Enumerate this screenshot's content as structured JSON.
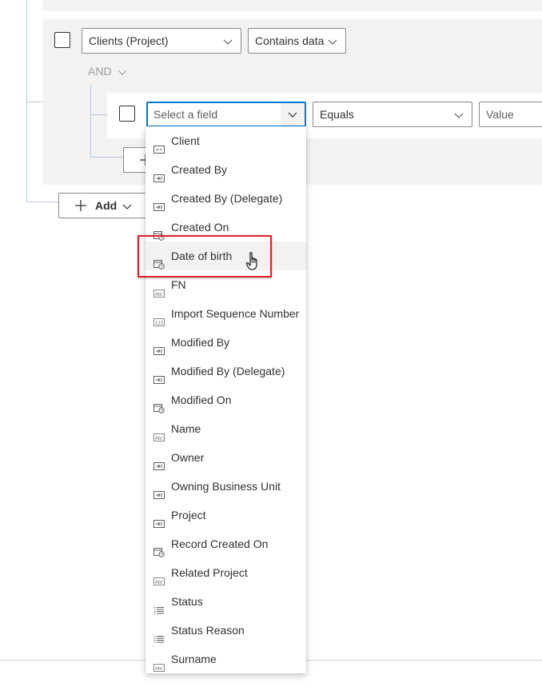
{
  "outer_group": {
    "condition": {
      "field": "Clients (Project)",
      "operator": "Contains data"
    },
    "nested_logic": "AND",
    "nested_condition": {
      "field_placeholder": "Select a field",
      "operator": "Equals",
      "value_placeholder": "Value"
    }
  },
  "add_button": {
    "label": "Add"
  },
  "field_dropdown": {
    "hovered_item": "Date of birth",
    "items": [
      {
        "label": "Client",
        "icon": "lookup-field-icon"
      },
      {
        "label": "Created By",
        "icon": "user-lookup-icon"
      },
      {
        "label": "Created By (Delegate)",
        "icon": "user-lookup-icon"
      },
      {
        "label": "Created On",
        "icon": "datetime-icon"
      },
      {
        "label": "Date of birth",
        "icon": "datetime-icon"
      },
      {
        "label": "FN",
        "icon": "text-field-icon"
      },
      {
        "label": "Import Sequence Number",
        "icon": "number-field-icon"
      },
      {
        "label": "Modified By",
        "icon": "user-lookup-icon"
      },
      {
        "label": "Modified By (Delegate)",
        "icon": "user-lookup-icon"
      },
      {
        "label": "Modified On",
        "icon": "datetime-icon"
      },
      {
        "label": "Name",
        "icon": "text-field-icon"
      },
      {
        "label": "Owner",
        "icon": "user-lookup-icon"
      },
      {
        "label": "Owning Business Unit",
        "icon": "user-lookup-icon"
      },
      {
        "label": "Project",
        "icon": "user-lookup-icon"
      },
      {
        "label": "Record Created On",
        "icon": "datetime-icon"
      },
      {
        "label": "Related Project",
        "icon": "text-field-icon"
      },
      {
        "label": "Status",
        "icon": "choice-field-icon"
      },
      {
        "label": "Status Reason",
        "icon": "choice-field-icon"
      },
      {
        "label": "Surname",
        "icon": "text-field-icon"
      }
    ]
  },
  "colors": {
    "focus_border": "#0078d4",
    "highlight_box": "#e0202a",
    "panel_bg": "#f3f2f1"
  }
}
